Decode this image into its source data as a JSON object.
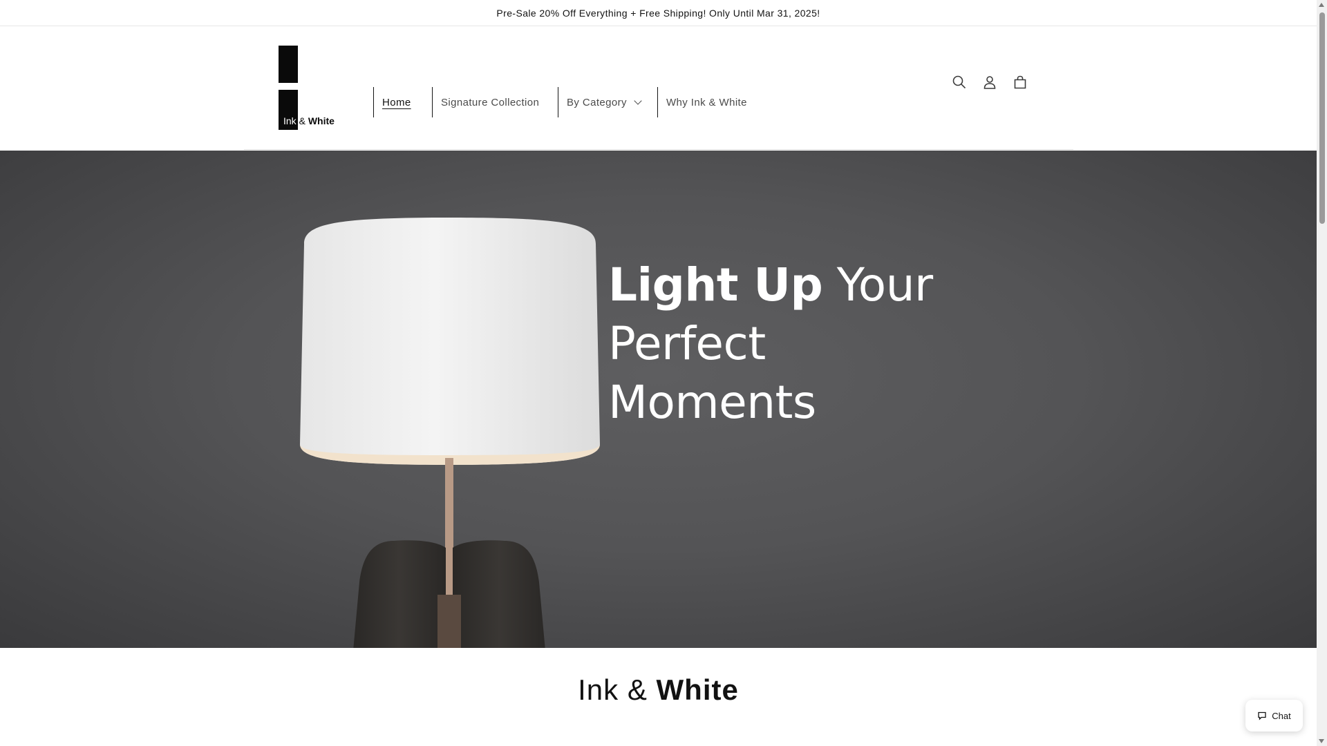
{
  "announcement": {
    "text": "Pre-Sale 20% Off Everything + Free Shipping! Only Until Mar 31, 2025!"
  },
  "logo": {
    "word_a": "Ink",
    "word_amp": " & ",
    "word_b": "White"
  },
  "nav": {
    "home": "Home",
    "signature": "Signature Collection",
    "category": "By Category",
    "why": "Why Ink & White"
  },
  "header_icons": [
    "search-icon",
    "account-icon",
    "cart-icon"
  ],
  "hero": {
    "line1_strong": "Light Up",
    "line1_light": " Your",
    "line2": "Perfect",
    "line3": "Moments"
  },
  "brand": {
    "light": "Ink & ",
    "bold": "White"
  },
  "chat": {
    "label": "Chat"
  },
  "colors": {
    "hero_bg": "#58585a",
    "text": "#121212",
    "nav_text": "#4a4a4a"
  }
}
